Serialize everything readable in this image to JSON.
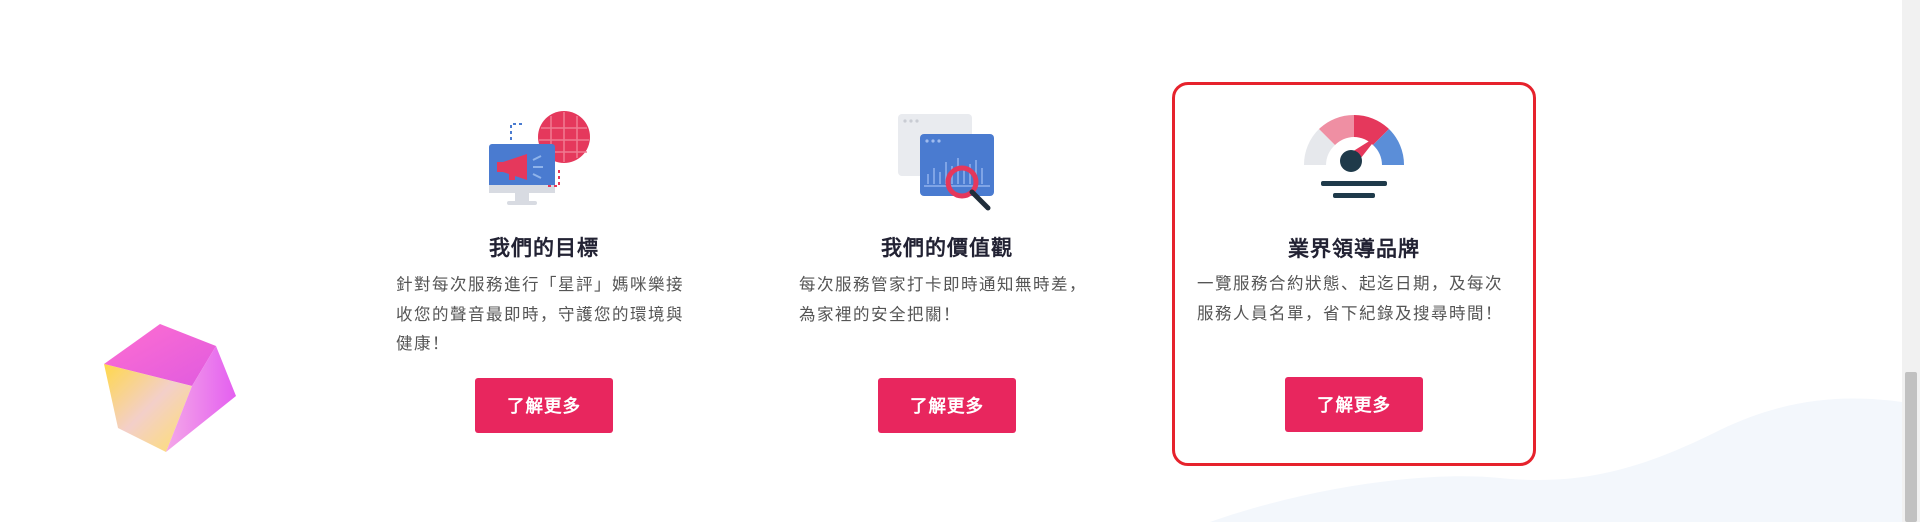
{
  "colors": {
    "accent_button": "#e8265e",
    "highlight_border": "#e6222c",
    "title_text": "#222233",
    "body_text": "#555555"
  },
  "cards": [
    {
      "icon": "megaphone-monitor-icon",
      "title": "我們的目標",
      "desc": "針對每次服務進行「星評」媽咪樂接收您的聲音最即時，守護您的環境與健康！",
      "button": "了解更多"
    },
    {
      "icon": "browser-search-chart-icon",
      "title": "我們的價值觀",
      "desc": "每次服務管家打卡即時通知無時差，為家裡的安全把關！",
      "button": "了解更多"
    },
    {
      "icon": "speedometer-gauge-icon",
      "title": "業界領導品牌",
      "desc": "一覽服務合約狀態、起迄日期，及每次服務人員名單，省下紀錄及搜尋時間！",
      "button": "了解更多",
      "highlighted": true
    }
  ],
  "decorations": {
    "cube": "gradient-cube-icon",
    "wave": "background-wave"
  }
}
